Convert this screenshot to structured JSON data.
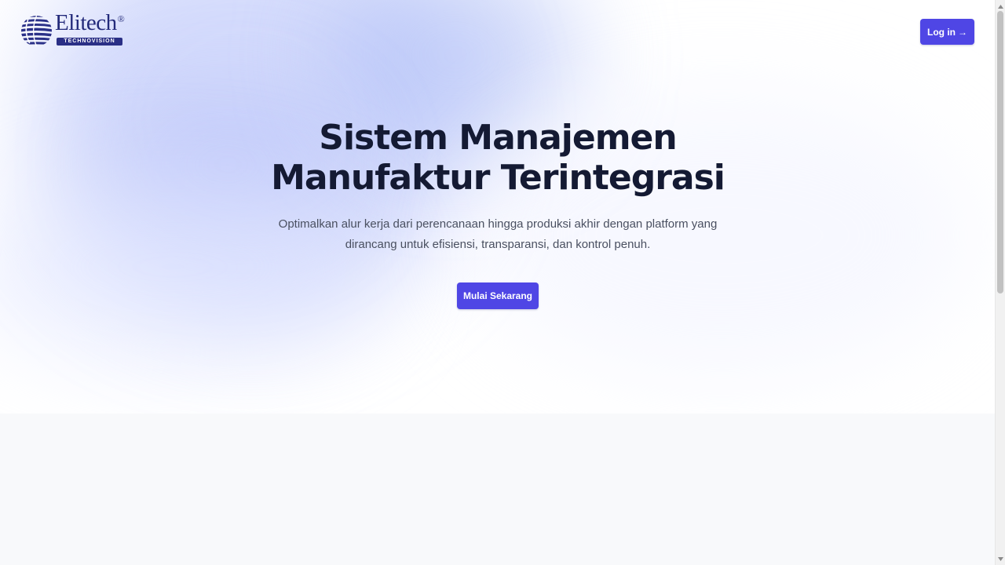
{
  "brand": {
    "name": "Elitech",
    "registered_mark": "®",
    "tagline": "TECHNOVISION",
    "logo_icon": "striped-globe-icon",
    "color": "#232a7a"
  },
  "header": {
    "login_label": "Log in",
    "login_arrow": "→"
  },
  "hero": {
    "title_line1": "Sistem Manajemen",
    "title_line2": "Manufaktur Terintegrasi",
    "subtitle_line1": "Optimalkan alur kerja dari perencanaan hingga produksi akhir dengan platform yang",
    "subtitle_line2": "dirancang untuk efisiensi, transparansi, dan kontrol penuh.",
    "cta_label": "Mulai Sekarang"
  },
  "colors": {
    "accent": "#4f46e5",
    "title_text": "#141a33",
    "body_text": "#4a5060",
    "section_bg": "#f8f9fb"
  },
  "scrollbar": {
    "up_icon": "scroll-up-arrow-icon",
    "down_icon": "scroll-down-arrow-icon"
  }
}
